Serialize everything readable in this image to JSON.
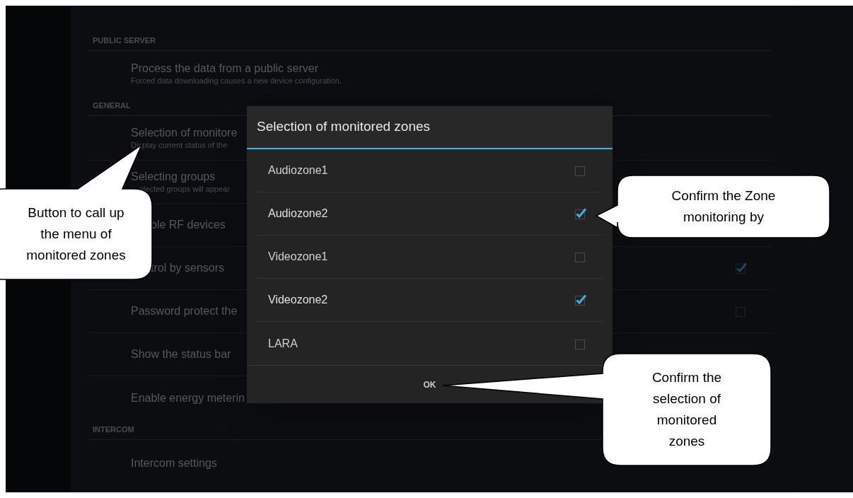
{
  "sections": [
    {
      "header": "PUBLIC SERVER",
      "items": [
        {
          "title": "Process the data from a public server",
          "summary": "Forced data downloading causes a new device configuration."
        }
      ]
    },
    {
      "header": "GENERAL",
      "items": [
        {
          "title": "Selection of monitore",
          "summary": "Display current status of the"
        },
        {
          "title": "Selecting groups",
          "summary": "elected groups will appear"
        },
        {
          "title": "ble RF devices"
        },
        {
          "title": "trol by sensors",
          "checked": true
        },
        {
          "title": "Password protect the",
          "checked": false
        },
        {
          "title": "Show the status bar"
        },
        {
          "title": "Enable energy meterin"
        }
      ]
    },
    {
      "header": "INTERCOM",
      "items": [
        {
          "title": "Intercom settings"
        }
      ]
    }
  ],
  "dialog": {
    "title": "Selection of monitored zones",
    "options": [
      {
        "label": "Audiozone1",
        "checked": false
      },
      {
        "label": "Audiozone2",
        "checked": true
      },
      {
        "label": "Videozone1",
        "checked": false
      },
      {
        "label": "Videozone2",
        "checked": true
      },
      {
        "label": "LARA",
        "checked": false
      }
    ],
    "button": "OK"
  },
  "callouts": [
    {
      "text": "Button to call up the menu of monitored zones"
    },
    {
      "text": "Confirm the Zone monitoring by"
    },
    {
      "text": "Confirm the selection of monitored zones"
    }
  ]
}
